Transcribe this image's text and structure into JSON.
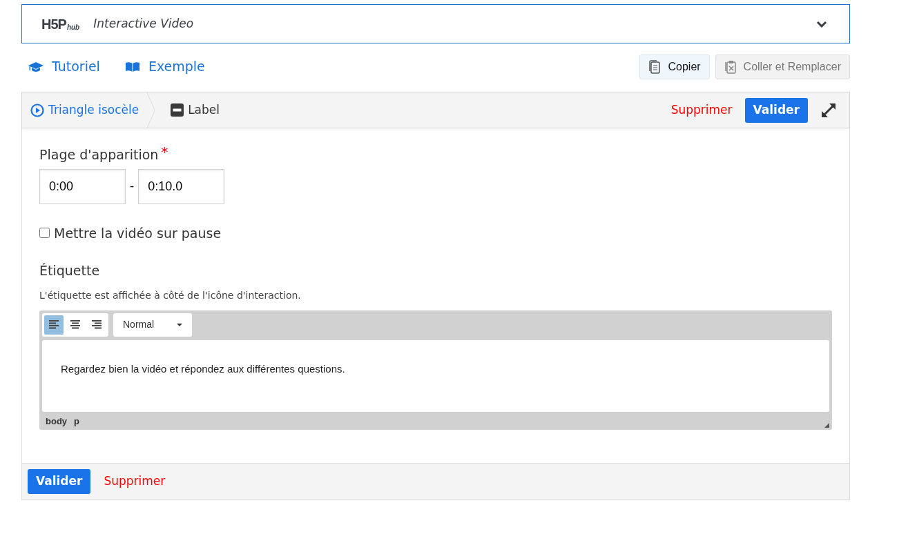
{
  "header": {
    "logo": {
      "main": "H5P",
      "sub": "hub"
    },
    "title": "Interactive Video",
    "expanded": false
  },
  "links": [
    {
      "kind": "tutorial",
      "label": "Tutoriel"
    },
    {
      "kind": "example",
      "label": "Exemple"
    }
  ],
  "clipboard": [
    {
      "kind": "copy",
      "label": "Copier",
      "disabled": false
    },
    {
      "kind": "paste",
      "label": "Coller et Remplacer",
      "disabled": true
    }
  ],
  "editor": {
    "breadcrumb": [
      {
        "kind": "video",
        "label": "Triangle isocèle"
      },
      {
        "kind": "label",
        "label": "Label"
      }
    ],
    "top_actions": {
      "delete": "Supprimer",
      "confirm": "Valider"
    },
    "range": {
      "label": "Plage d'apparition",
      "required_mark": "*",
      "from": "0:00",
      "separator": "-",
      "to": "0:10.0"
    },
    "pause": {
      "label": "Mettre la vidéo sur pause",
      "checked": false
    },
    "field": {
      "label": "Étiquette",
      "description": "L'étiquette est affichée à côté de l'icône d'interaction.",
      "align": [
        {
          "kind": "left",
          "selected": true
        },
        {
          "kind": "center",
          "selected": false
        },
        {
          "kind": "right",
          "selected": false
        }
      ],
      "format": "Normal",
      "content": "Regardez bien la vidéo et répondez aux différentes questions.",
      "path": [
        "body",
        "p"
      ]
    },
    "bottom_actions": {
      "confirm": "Valider",
      "delete": "Supprimer"
    }
  }
}
